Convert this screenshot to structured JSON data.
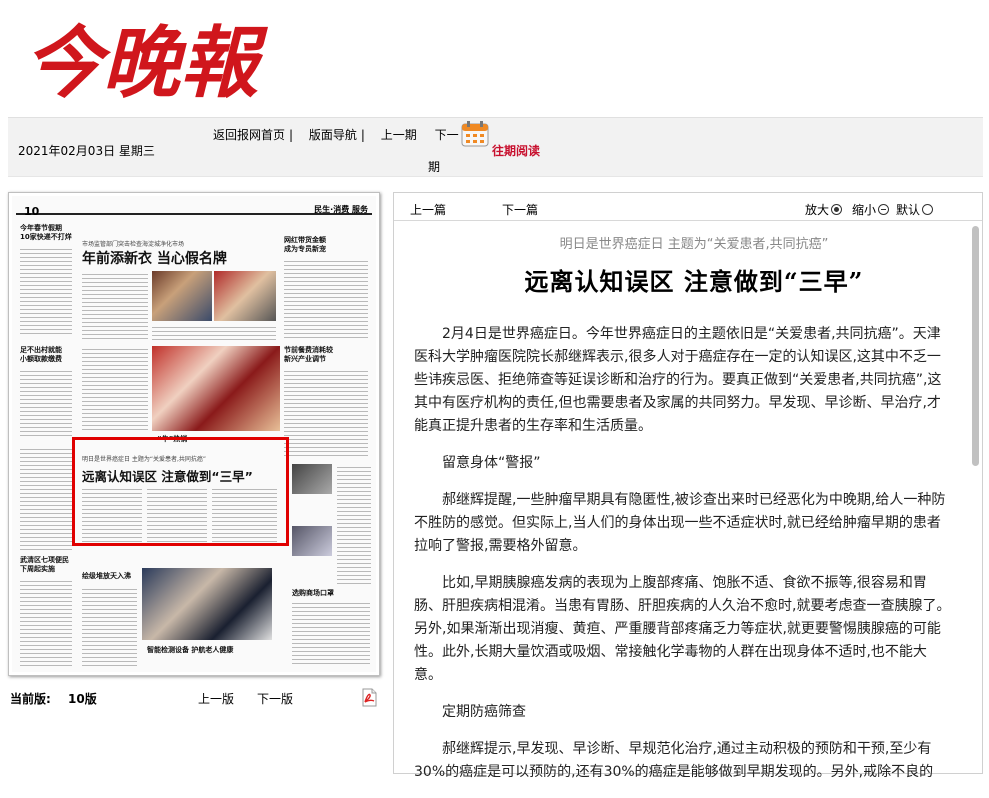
{
  "brand": {
    "logo_text": "今晚報",
    "logo_color": "#d0161c"
  },
  "topbar": {
    "date": "2021年02月03日 星期三",
    "nav": [
      "返回报网首页",
      "版面导航",
      "上一期",
      "下一期"
    ],
    "sep": "|",
    "past_read": "往期阅读",
    "next_issue_a": "下一",
    "next_issue_b": "期"
  },
  "thumbnail": {
    "page_num": "10",
    "section": "民生·消费 服务",
    "headline_1": "年前添新衣 当心假名牌",
    "kicker_1": "市场监管部门突击检查海淀城净化市场",
    "headline_2": "远离认知误区 注意做到“三早”",
    "kicker_2": "明日是世界癌症日 主题为“关爱患者,共同抗癌”",
    "side_1": "今年春节假期\n10家快递不打烊",
    "side_2": "足不出村就能\n小额取款缴费",
    "side_3": "武清区七项便民\n下周起实施",
    "side_4": "绘级堆放天入沸",
    "right_1": "网红带货金额\n成为专员新宠",
    "right_2": "节前餐费消耗较\n新兴产业调节",
    "right_3": "选购商场口罩",
    "caption_1": "“牛”热销",
    "caption_2": "智能检测设备 护航老人健康"
  },
  "bottom": {
    "current_label": "当前版:",
    "version": "10版",
    "prev": "上一版",
    "next": "下一版"
  },
  "toolbar": {
    "prev": "上一篇",
    "next": "下一篇",
    "zoom_in": "放大",
    "zoom_out": "缩小",
    "default": "默认"
  },
  "article": {
    "subtitle": "明日是世界癌症日 主题为“关爱患者,共同抗癌”",
    "title": "远离认知误区 注意做到“三早”",
    "paragraphs": [
      "2月4日是世界癌症日。今年世界癌症日的主题依旧是“关爱患者,共同抗癌”。天津医科大学肿瘤医院院长郝继辉表示,很多人对于癌症存在一定的认知误区,这其中不乏一些讳疾忌医、拒绝筛查等延误诊断和治疗的行为。要真正做到“关爱患者,共同抗癌”,这其中有医疗机构的责任,但也需要患者及家属的共同努力。早发现、早诊断、早治疗,才能真正提升患者的生存率和生活质量。",
      "留意身体“警报”",
      "郝继辉提醒,一些肿瘤早期具有隐匿性,被诊查出来时已经恶化为中晚期,给人一种防不胜防的感觉。但实际上,当人们的身体出现一些不适症状时,就已经给肿瘤早期的患者拉响了警报,需要格外留意。",
      "比如,早期胰腺癌发病的表现为上腹部疼痛、饱胀不适、食欲不振等,很容易和胃肠、肝胆疾病相混淆。当患有胃肠、肝胆疾病的人久治不愈时,就要考虑查一查胰腺了。另外,如果渐渐出现消瘦、黄疸、严重腰背部疼痛乏力等症状,就更要警惕胰腺癌的可能性。此外,长期大量饮酒或吸烟、常接触化学毒物的人群在出现身体不适时,也不能大意。",
      "定期防癌筛查",
      "郝继辉提示,早发现、早诊断、早规范化治疗,通过主动积极的预防和干预,至少有30%的癌症是可以预防的,还有30%的癌症是能够做到早期发现的。另外,戒除不良的"
    ]
  }
}
